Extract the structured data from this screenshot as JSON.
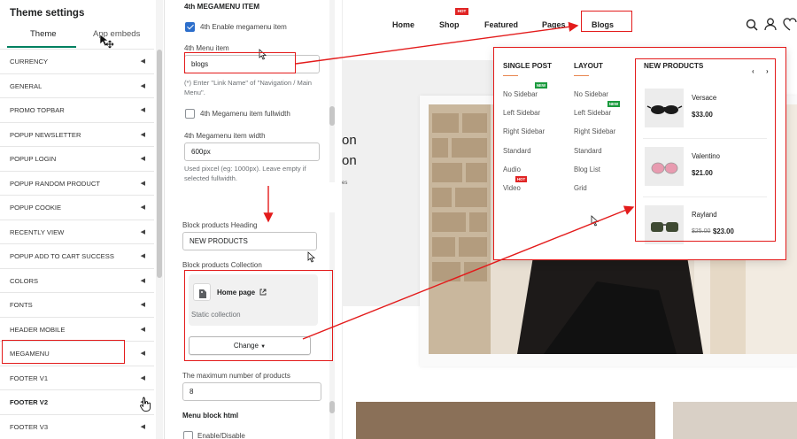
{
  "sidebar": {
    "title": "Theme settings",
    "tabs": [
      "Theme",
      "App embeds"
    ],
    "items": [
      {
        "label": "CURRENCY"
      },
      {
        "label": "GENERAL"
      },
      {
        "label": "PROMO TOPBAR"
      },
      {
        "label": "POPUP NEWSLETTER"
      },
      {
        "label": "POPUP LOGIN"
      },
      {
        "label": "POPUP RANDOM PRODUCT"
      },
      {
        "label": "POPUP COOKIE"
      },
      {
        "label": "RECENTLY VIEW"
      },
      {
        "label": "POPUP ADD TO CART SUCCESS"
      },
      {
        "label": "COLORS"
      },
      {
        "label": "FONTS"
      },
      {
        "label": "HEADER MOBILE"
      },
      {
        "label": "MEGAMENU"
      },
      {
        "label": "FOOTER V1"
      },
      {
        "label": "FOOTER V2"
      },
      {
        "label": "FOOTER V3"
      }
    ],
    "chevron": "◀"
  },
  "panel": {
    "section_heading": "4th MEGAMENU ITEM",
    "enable_label": "4th Enable megamenu item",
    "enable_checked": true,
    "menu_item_label": "4th Menu item",
    "menu_item_value": "blogs",
    "menu_item_help": "(*) Enter \"Link Name\" of \"Navigation / Main Menu\".",
    "fullwidth_label": "4th Megamenu item fullwidth",
    "fullwidth_checked": false,
    "width_label": "4th Megamenu item width",
    "width_value": "600px",
    "width_help": "Used pixcel (eg: 1000px). Leave empty if selected fullwidth.",
    "block_heading_label": "Block products Heading",
    "block_heading_value": "NEW PRODUCTS",
    "block_collection_label": "Block products Collection",
    "collection_name": "Home page",
    "collection_type": "Static collection",
    "change_label": "Change",
    "max_products_label": "The maximum number of products",
    "max_products_value": "8",
    "menu_block_html_label": "Menu block html",
    "enable_disable_label": "Enable/Disable"
  },
  "store": {
    "nav": [
      "Home",
      "Shop",
      "Featured",
      "Pages",
      "Blogs"
    ],
    "hot": "HOT",
    "hero_line1": "on",
    "hero_line2": "on",
    "hero_line3": "es",
    "mega": {
      "col1_title": "SINGLE POST",
      "col1_links": [
        "No Sidebar",
        "Left Sidebar",
        "Right Sidebar",
        "Standard",
        "Audio",
        "Video"
      ],
      "col2_title": "LAYOUT",
      "col2_links": [
        "No Sidebar",
        "Left Sidebar",
        "Right Sidebar",
        "Standard",
        "Blog List",
        "Grid"
      ],
      "new_badge": "NEW",
      "hot_badge": "HOT",
      "products_title": "NEW PRODUCTS",
      "products": [
        {
          "name": "Versace",
          "price": "$33.00",
          "old_price": ""
        },
        {
          "name": "Valentino",
          "price": "$21.00",
          "old_price": ""
        },
        {
          "name": "Rayland",
          "price": "$23.00",
          "old_price": "$25.00"
        }
      ],
      "prev": "‹",
      "next": "›"
    }
  },
  "colors": {
    "annotation_red": "#e31b1b",
    "accent_green": "#008060",
    "checkbox_blue": "#2c6ecb"
  }
}
